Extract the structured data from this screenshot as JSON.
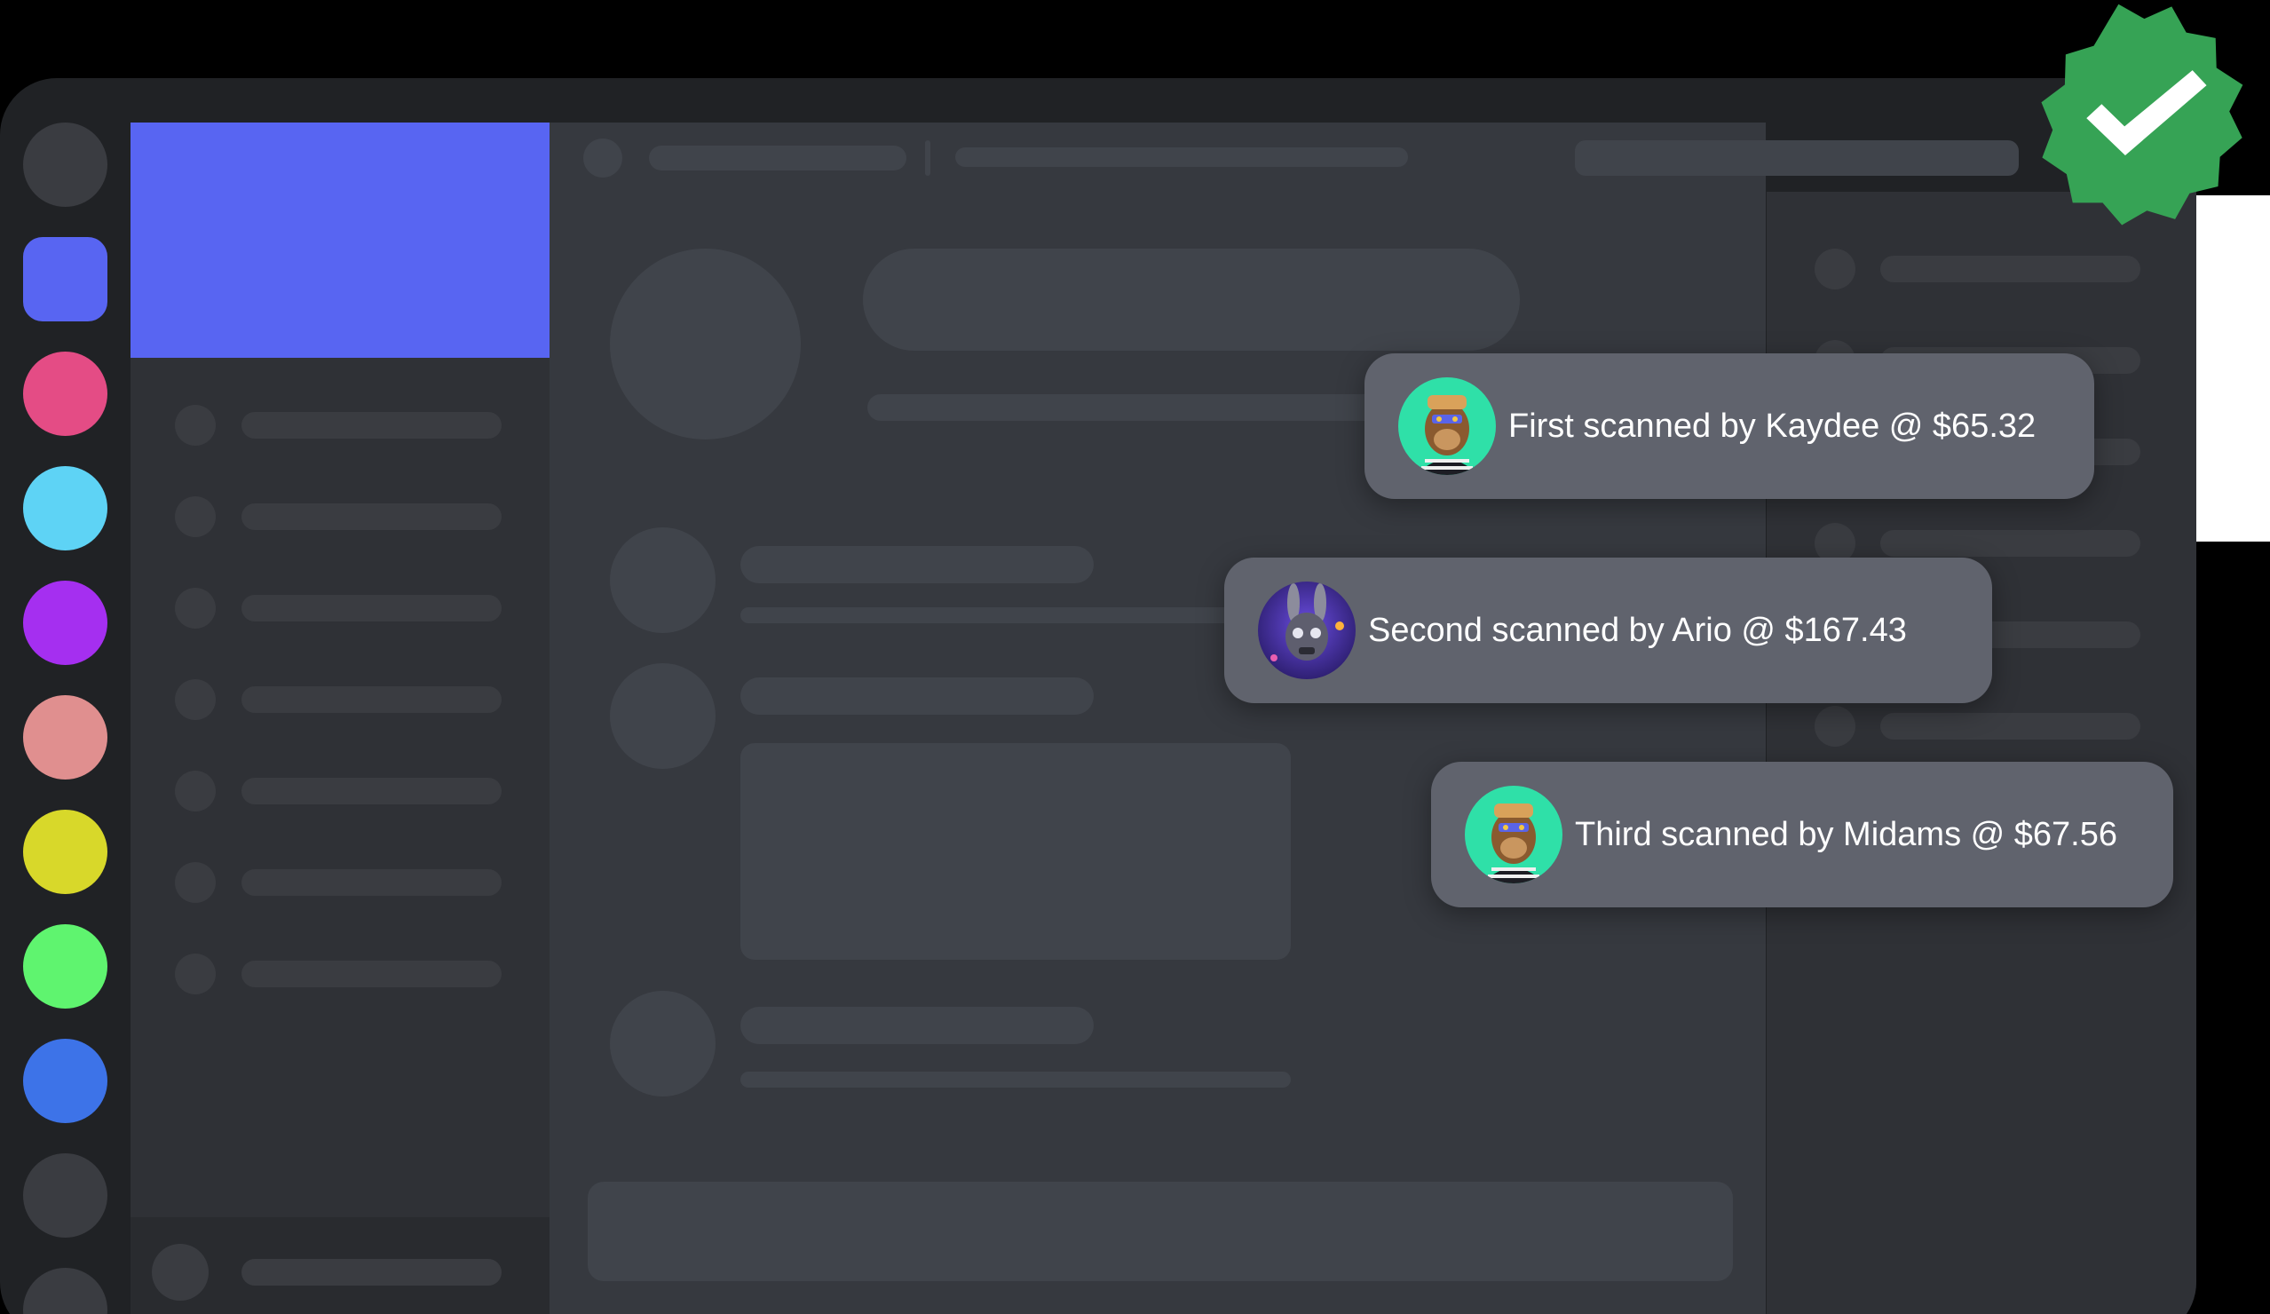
{
  "colors": {
    "accent": "#5865f2",
    "servers": [
      "#3a3c41",
      "#5865f2",
      "#e44c85",
      "#5ed3f5",
      "#a52ff0",
      "#e08f8f",
      "#d8d82a",
      "#5ff46f",
      "#3d73e8",
      "#3a3c41",
      "#3a3c41"
    ],
    "badge": "#36a355",
    "notification_bg": "#60636d"
  },
  "notifications": [
    {
      "text": "First scanned by Kaydee @ $65.32",
      "avatar": "ape-avatar-icon"
    },
    {
      "text": "Second scanned by Ario @ $167.43",
      "avatar": "robot-rabbit-avatar-icon"
    },
    {
      "text": "Third scanned by Midams @ $67.56",
      "avatar": "ape-avatar-icon"
    }
  ],
  "badge": {
    "icon": "verified-check-icon"
  }
}
